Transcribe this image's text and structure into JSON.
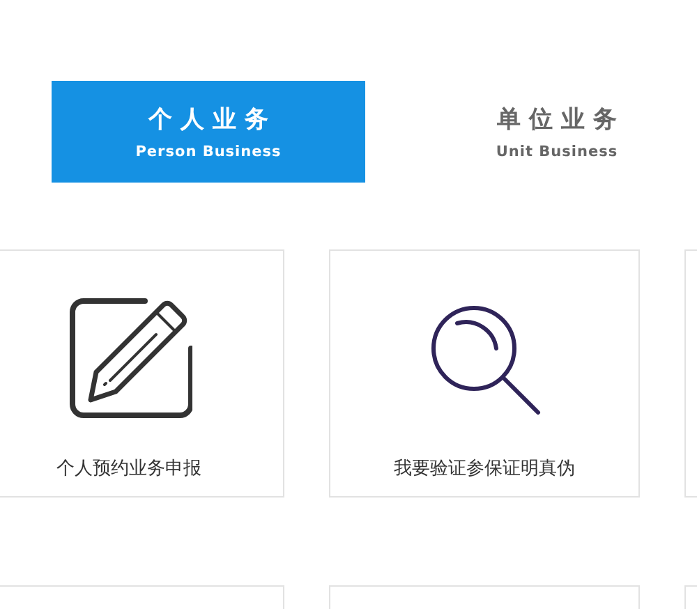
{
  "tabs": [
    {
      "label": "个 人 业 务",
      "sublabel": "Person Business",
      "selected": true
    },
    {
      "label": "单 位 业 务",
      "sublabel": "Unit Business",
      "selected": false
    }
  ],
  "cards": [
    {
      "kind": "edit",
      "label": "个人预约业务申报"
    },
    {
      "kind": "search",
      "label": "我要验证参保证明真伪"
    },
    {
      "kind": "blank"
    },
    {
      "kind": "blank"
    },
    {
      "kind": "blank"
    },
    {
      "kind": "blank"
    }
  ]
}
